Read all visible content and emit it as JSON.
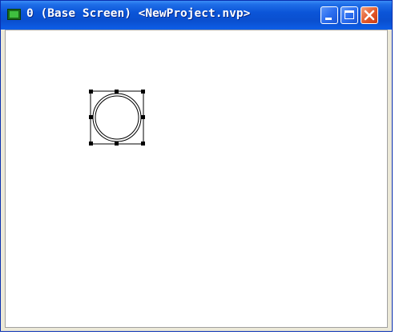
{
  "window": {
    "title": "0 (Base Screen) <NewProject.nvp>"
  },
  "titlebar_buttons": {
    "minimize": "minimize",
    "maximize": "maximize",
    "close": "close"
  },
  "icons": {
    "app": "screen-icon",
    "minimize": "minimize-icon",
    "maximize": "maximize-icon",
    "close": "close-icon"
  },
  "canvas": {
    "parts": [
      {
        "type": "circle",
        "selected": true
      }
    ]
  },
  "colors": {
    "titlebar": "#0a54d6",
    "canvas": "#ffffff",
    "close_button": "#e2582a"
  }
}
